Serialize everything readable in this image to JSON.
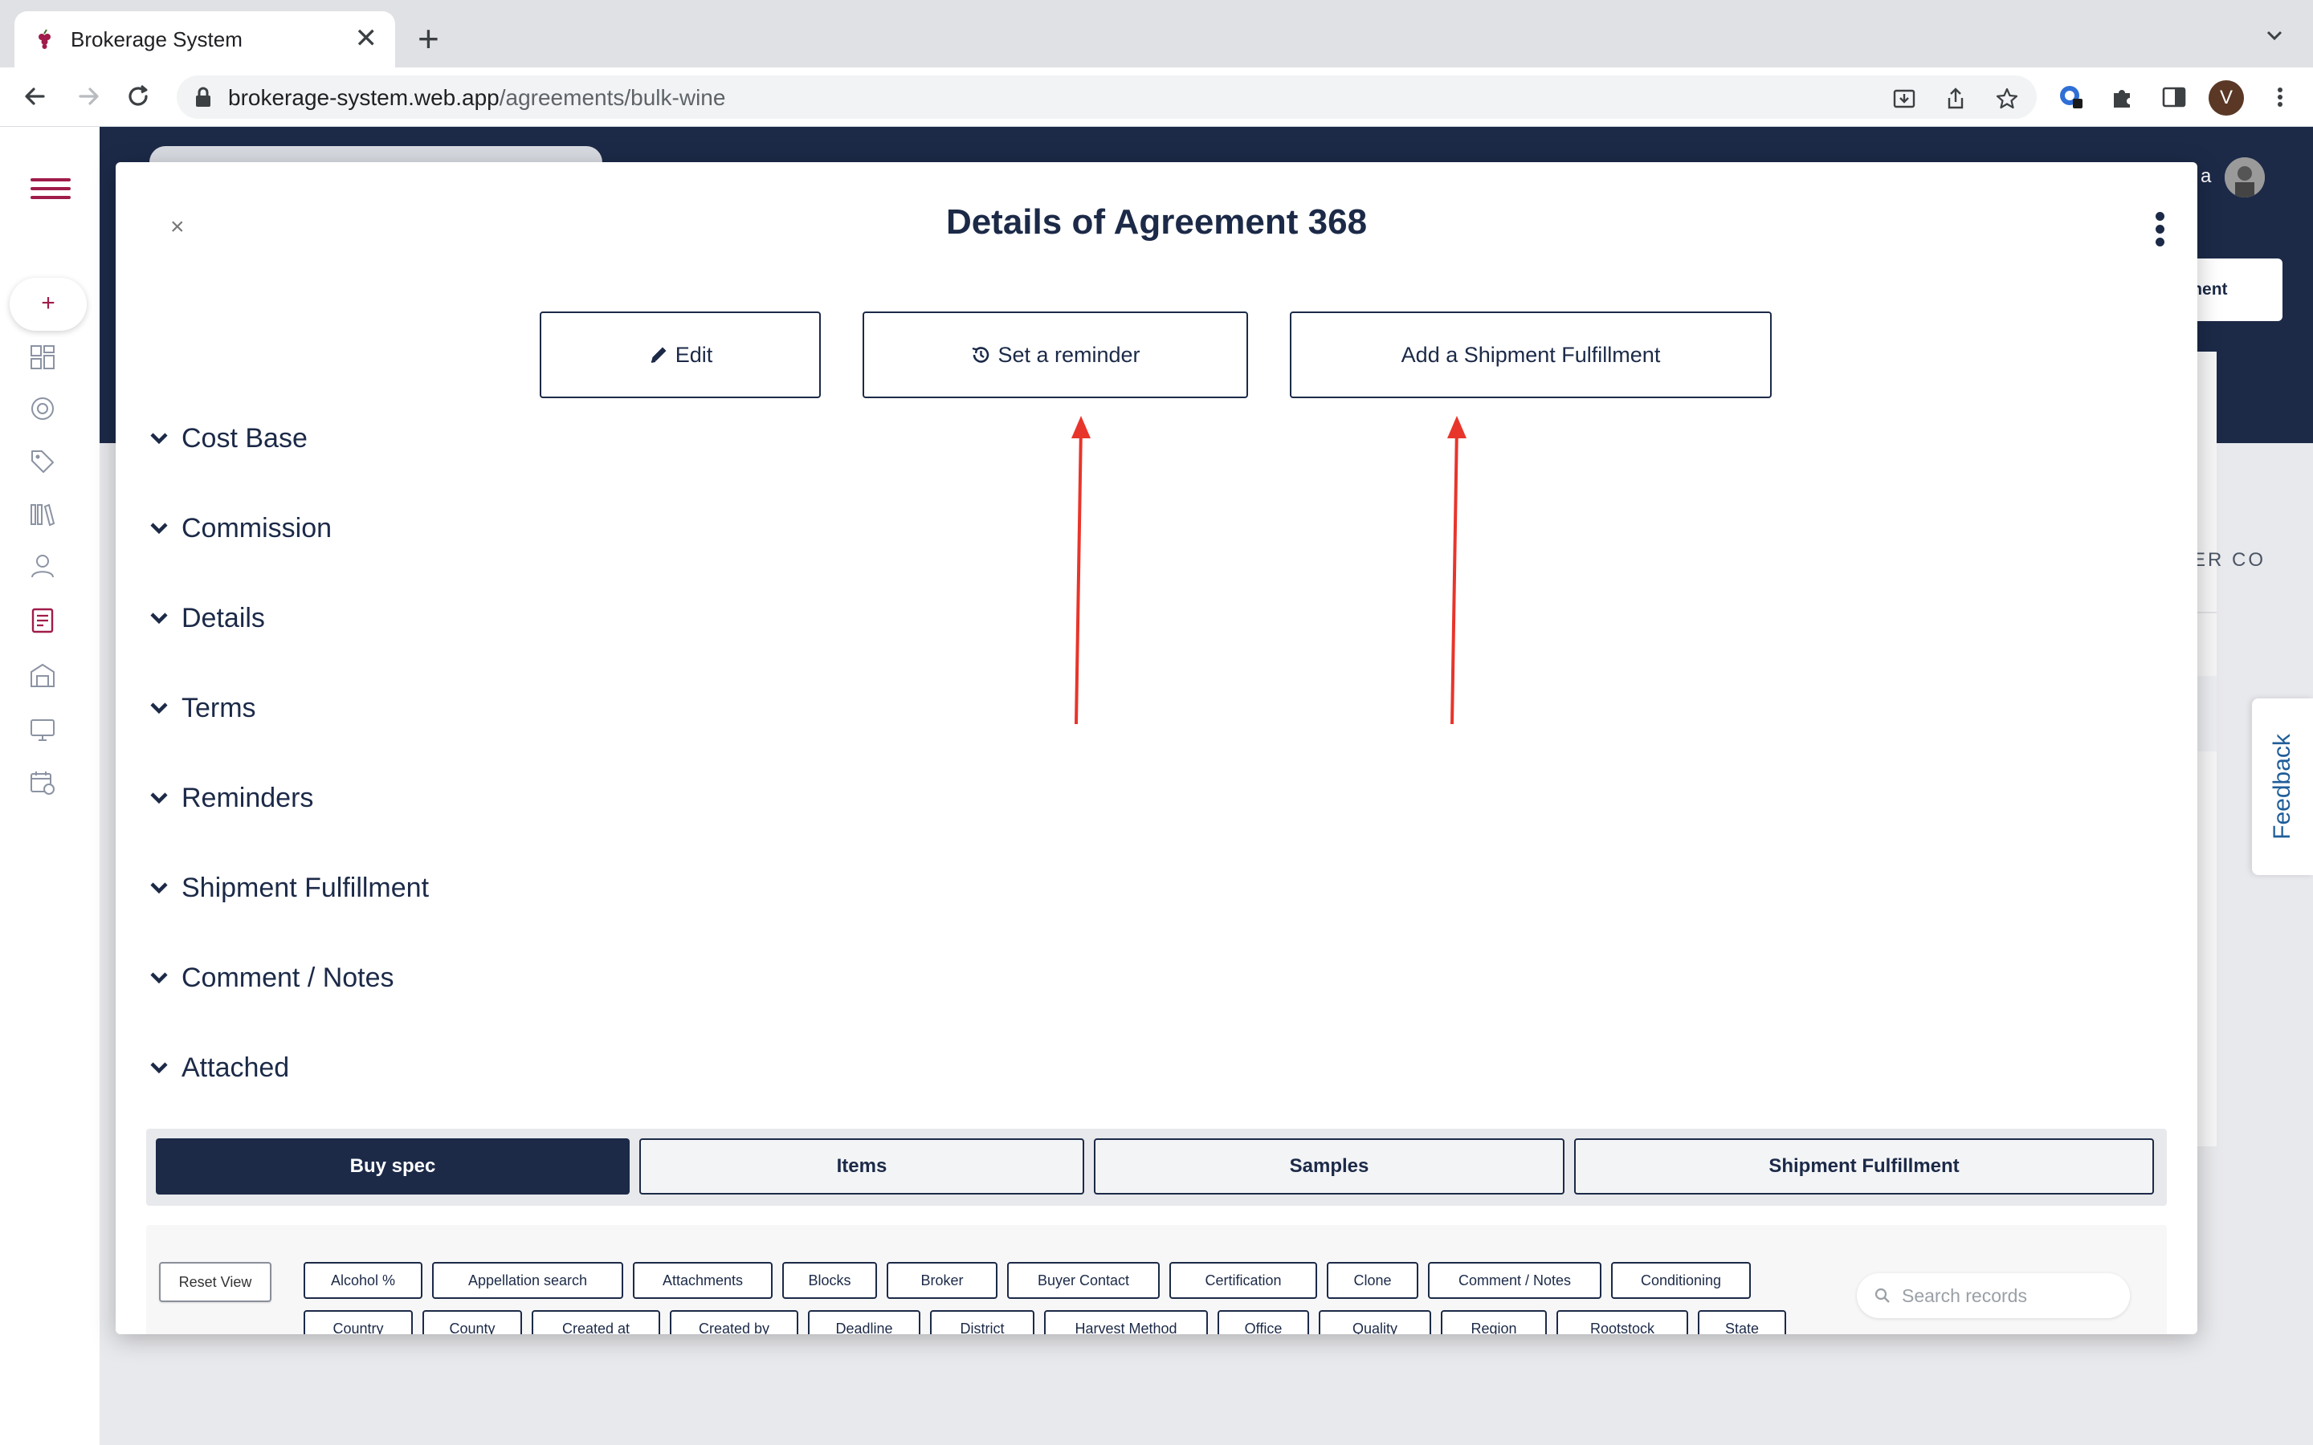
{
  "browser": {
    "tab_title": "Brokerage System",
    "tab_close": "✕",
    "new_tab": "+",
    "url_host": "brokerage-system.web.app",
    "url_path": "/agreements/bulk-wine",
    "profile_initial": "V"
  },
  "app": {
    "header_partial_text": "a",
    "top_button_partial": "eement",
    "column_header_partial": "ER CO",
    "feedback_label": "Feedback",
    "add_button": "+"
  },
  "modal": {
    "close": "×",
    "title": "Details of Agreement 368",
    "actions": {
      "edit": "Edit",
      "reminder": "Set a reminder",
      "shipment": "Add a Shipment Fulfillment"
    },
    "sections": [
      "Cost Base",
      "Commission",
      "Details",
      "Terms",
      "Reminders",
      "Shipment Fulfillment",
      "Comment / Notes",
      "Attached"
    ],
    "tabs": [
      "Buy spec",
      "Items",
      "Samples",
      "Shipment Fulfillment"
    ],
    "grid": {
      "reset_view": "Reset View",
      "columns_row1": [
        "Alcohol %",
        "Appellation search",
        "Attachments",
        "Blocks",
        "Broker",
        "Buyer Contact",
        "Certification",
        "Clone",
        "Comment / Notes",
        "Conditioning"
      ],
      "columns_row2": [
        "Country",
        "County",
        "Created at",
        "Created by",
        "Deadline",
        "District",
        "Harvest Method",
        "Office",
        "Quality",
        "Region",
        "Rootstock",
        "State"
      ],
      "search_placeholder": "Search records"
    }
  },
  "colors": {
    "navy": "#1c2a48",
    "brand_wine": "#a01c4a",
    "annotation_red": "#e8352b",
    "feedback_blue": "#1f5d99"
  }
}
